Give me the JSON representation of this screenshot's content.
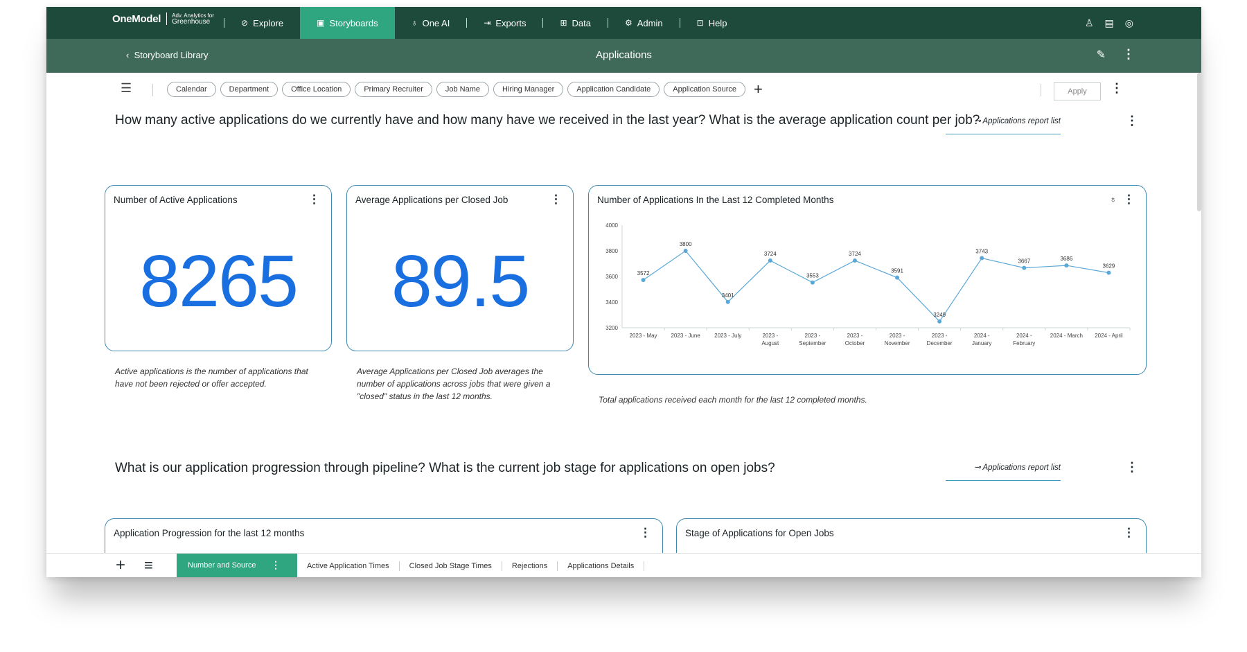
{
  "nav": {
    "logo": "OneModel",
    "logo_sub_small": "Adv. Analytics for",
    "logo_sub_big": "Greenhouse",
    "items": [
      {
        "label": "Explore",
        "icon": "compass-icon",
        "active": false
      },
      {
        "label": "Storyboards",
        "icon": "storyboard-icon",
        "active": true
      },
      {
        "label": "One AI",
        "icon": "lightbulb-icon",
        "active": false
      },
      {
        "label": "Exports",
        "icon": "export-icon",
        "active": false
      },
      {
        "label": "Data",
        "icon": "data-icon",
        "active": false
      },
      {
        "label": "Admin",
        "icon": "gear-icon",
        "active": false
      },
      {
        "label": "Help",
        "icon": "help-icon",
        "active": false
      }
    ]
  },
  "subheader": {
    "back_label": "Storyboard Library",
    "title": "Applications"
  },
  "filters": {
    "chips": [
      "Calendar",
      "Department",
      "Office Location",
      "Primary Recruiter",
      "Job Name",
      "Hiring Manager",
      "Application Candidate",
      "Application Source"
    ],
    "apply_label": "Apply"
  },
  "section1": {
    "question": "How many active applications do we currently have and how many have we received in the last year? What is the average application count per job?",
    "report_link": "Applications report list"
  },
  "cards": {
    "active": {
      "title": "Number of Active Applications",
      "value": "8265",
      "caption": "Active applications is the number of applications that have not been rejected or offer accepted."
    },
    "avg": {
      "title": "Average Applications per Closed Job",
      "value": "89.5",
      "caption": "Average Applications per Closed Job averages the number of applications across jobs that were given a \"closed\" status in the last 12 months."
    },
    "chart": {
      "title": "Number of Applications In the Last 12 Completed Months",
      "caption": "Total applications received each month for the last 12 completed months."
    }
  },
  "chart_data": {
    "type": "line",
    "title": "Number of Applications In the Last 12 Completed Months",
    "categories": [
      [
        "2023 - May"
      ],
      [
        "2023 - June"
      ],
      [
        "2023 - July"
      ],
      [
        "2023 -",
        "August"
      ],
      [
        "2023 -",
        "September"
      ],
      [
        "2023 -",
        "October"
      ],
      [
        "2023 -",
        "November"
      ],
      [
        "2023 -",
        "December"
      ],
      [
        "2024 -",
        "January"
      ],
      [
        "2024 -",
        "February"
      ],
      [
        "2024 - March"
      ],
      [
        "2024 - April"
      ]
    ],
    "values": [
      3572,
      3800,
      3401,
      3724,
      3553,
      3724,
      3591,
      3249,
      3743,
      3667,
      3686,
      3629
    ],
    "ylim": [
      3200,
      4000
    ],
    "yticks": [
      3200,
      3400,
      3600,
      3800,
      4000
    ],
    "grid": false,
    "color": "#5aa8d8"
  },
  "section2": {
    "question": "What is our application progression through pipeline? What is the current job stage for applications on open jobs?",
    "report_link": "Applications report list",
    "card_left": "Application Progression for the last 12 months",
    "card_right": "Stage of Applications for Open Jobs"
  },
  "bottom_tabs": {
    "active": "Number and Source",
    "others": [
      "Active Application Times",
      "Closed Job Stage Times",
      "Rejections",
      "Applications Details"
    ]
  }
}
